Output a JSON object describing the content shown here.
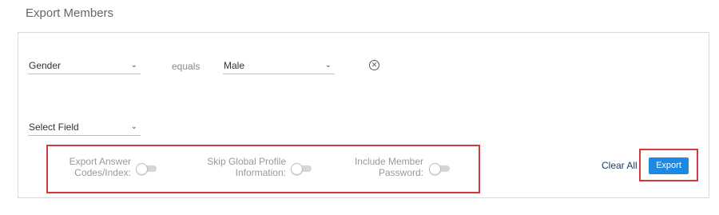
{
  "header": {
    "title": "Export Members"
  },
  "filters": [
    {
      "field": "Gender",
      "operator": "equals",
      "value": "Male"
    }
  ],
  "new_filter": {
    "field_placeholder": "Select Field"
  },
  "options": [
    {
      "label_line1": "Export Answer",
      "label_line2": "Codes/Index:",
      "enabled": false
    },
    {
      "label_line1": "Skip Global Profile",
      "label_line2": "Information:",
      "enabled": false
    },
    {
      "label_line1": "Include Member",
      "label_line2": "Password:",
      "enabled": false
    }
  ],
  "actions": {
    "clear_all": "Clear All",
    "export": "Export"
  },
  "colors": {
    "accent": "#1e88e5",
    "highlight": "#d23b3b"
  }
}
